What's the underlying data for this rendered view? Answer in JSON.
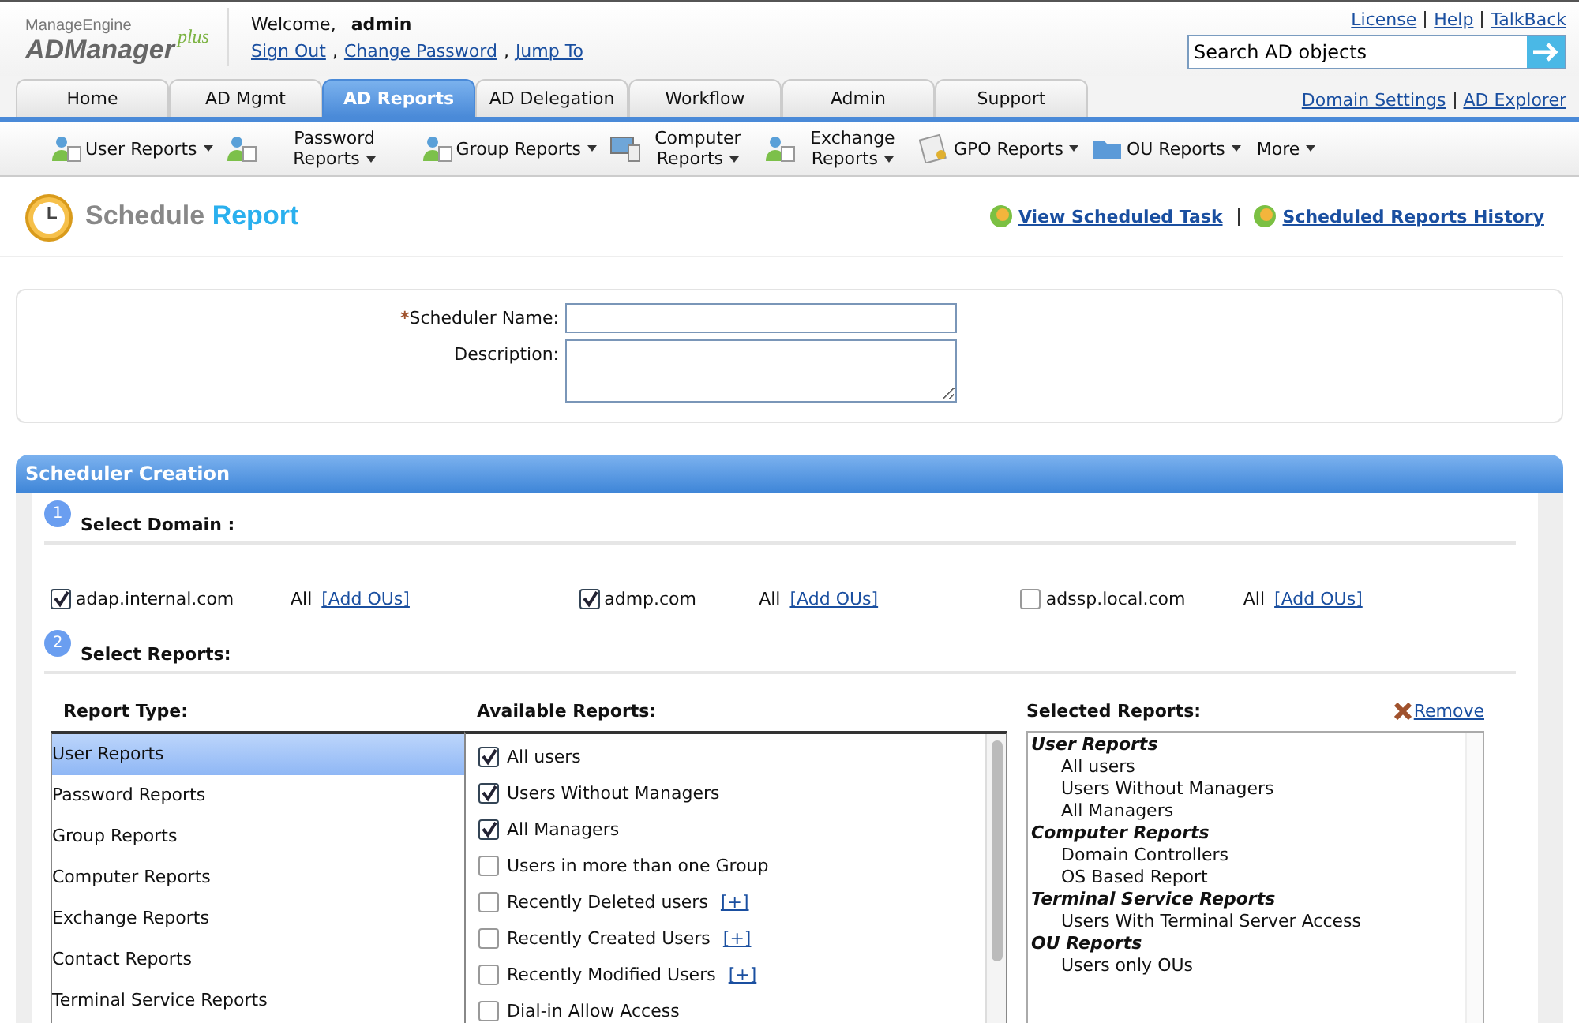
{
  "header": {
    "brand_top": "ManageEngine",
    "brand_name": "ADManager",
    "brand_plus": "plus",
    "welcome": "Welcome,",
    "user": "admin",
    "user_links": [
      {
        "label": "Sign Out"
      },
      {
        "label": "Change Password"
      },
      {
        "label": "Jump To"
      }
    ],
    "link_separator": ",",
    "top_links": [
      "License",
      "Help",
      "TalkBack"
    ],
    "search": {
      "value": "Search AD objects"
    }
  },
  "tabs": [
    {
      "label": "Home",
      "selected": false
    },
    {
      "label": "AD Mgmt",
      "selected": false
    },
    {
      "label": "AD Reports",
      "selected": true
    },
    {
      "label": "AD Delegation",
      "selected": false
    },
    {
      "label": "Workflow",
      "selected": false
    },
    {
      "label": "Admin",
      "selected": false
    },
    {
      "label": "Support",
      "selected": false
    }
  ],
  "tab_links": [
    "Domain Settings",
    "AD Explorer"
  ],
  "submenu": [
    {
      "label": "User Reports",
      "kind": "users"
    },
    {
      "label": "Password Reports",
      "kind": "users"
    },
    {
      "label": "Group Reports",
      "kind": "users"
    },
    {
      "label": "Computer Reports",
      "kind": "computer"
    },
    {
      "label": "Exchange Reports",
      "kind": "users"
    },
    {
      "label": "GPO Reports",
      "kind": "document"
    },
    {
      "label": "OU Reports",
      "kind": "folder"
    },
    {
      "label": "More",
      "kind": "plain"
    }
  ],
  "page": {
    "title_part1": "Schedule",
    "title_part2": "Report",
    "links": [
      "View Scheduled Task",
      "Scheduled Reports History"
    ]
  },
  "form": {
    "fields": [
      {
        "label": "Scheduler Name:",
        "required_mark": "*",
        "kind": "line"
      },
      {
        "label": "Description:",
        "kind": "area"
      }
    ]
  },
  "panel": {
    "title": "Scheduler Creation",
    "steps": [
      {
        "number": "1",
        "title": "Select Domain :"
      },
      {
        "number": "2",
        "title": "Select Reports:"
      }
    ],
    "domains": [
      {
        "name": "adap.internal.com",
        "checked": true,
        "scope": "All",
        "link": "[Add OUs]"
      },
      {
        "name": "admp.com",
        "checked": true,
        "scope": "All",
        "link": "[Add OUs]"
      },
      {
        "name": "adssp.local.com",
        "checked": false,
        "scope": "All",
        "link": "[Add OUs]"
      }
    ],
    "columns": [
      "Report Type:",
      "Available Reports:",
      "Selected Reports:"
    ],
    "remove": "Remove",
    "report_types": [
      {
        "label": "User Reports",
        "selected": true
      },
      {
        "label": "Password Reports",
        "selected": false
      },
      {
        "label": "Group Reports",
        "selected": false
      },
      {
        "label": "Computer Reports",
        "selected": false
      },
      {
        "label": "Exchange Reports",
        "selected": false
      },
      {
        "label": "Contact Reports",
        "selected": false
      },
      {
        "label": "Terminal Service Reports",
        "selected": false
      }
    ],
    "available": [
      {
        "label": "All users",
        "checked": true
      },
      {
        "label": "Users Without Managers",
        "checked": true
      },
      {
        "label": "All Managers",
        "checked": true
      },
      {
        "label": "Users in more than one Group",
        "checked": false
      },
      {
        "label": "Recently Deleted users",
        "checked": false,
        "more": "[+]"
      },
      {
        "label": "Recently Created Users",
        "checked": false,
        "more": "[+]"
      },
      {
        "label": "Recently Modified Users",
        "checked": false,
        "more": "[+]"
      },
      {
        "label": "Dial-in Allow Access",
        "checked": false
      }
    ],
    "selected_groups": [
      {
        "title": "User Reports",
        "items": [
          "All users",
          "Users Without Managers",
          "All Managers"
        ]
      },
      {
        "title": "Computer Reports",
        "items": [
          "Domain Controllers",
          "OS Based Report"
        ]
      },
      {
        "title": "Terminal Service Reports",
        "items": [
          "Users With Terminal Server Access"
        ]
      },
      {
        "title": "OU Reports",
        "items": [
          "Users only OUs"
        ]
      }
    ]
  }
}
